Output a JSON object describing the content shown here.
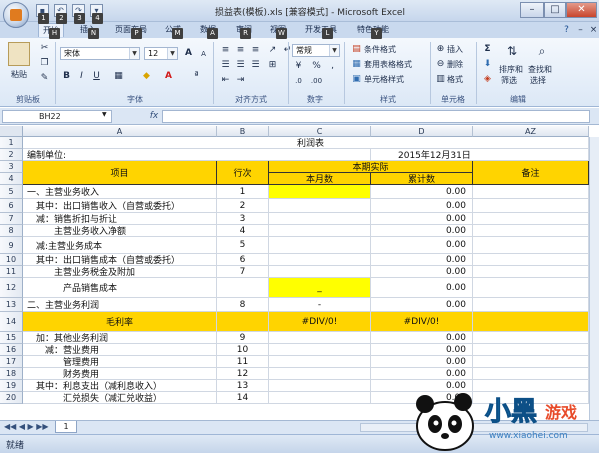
{
  "window": {
    "title": "损益表(模板).xls  [兼容模式] - Microsoft Excel",
    "minimize": "–",
    "maximize": "□",
    "close": "✕"
  },
  "qat": {
    "office_key": "F",
    "keys": [
      "1",
      "2",
      "3",
      "4"
    ]
  },
  "tabs": [
    {
      "label": "开始",
      "key": "H"
    },
    {
      "label": "插入",
      "key": "N"
    },
    {
      "label": "页面布局",
      "key": "P"
    },
    {
      "label": "公式",
      "key": "M"
    },
    {
      "label": "数据",
      "key": "A"
    },
    {
      "label": "审阅",
      "key": "R"
    },
    {
      "label": "视图",
      "key": "W"
    },
    {
      "label": "开发工具",
      "key": "L"
    },
    {
      "label": "特色功能",
      "key": "Y"
    }
  ],
  "ribbon": {
    "clipboard": {
      "paste": "粘贴",
      "label": "剪贴板"
    },
    "font": {
      "name": "宋体",
      "size": "12",
      "label": "字体",
      "bold": "B",
      "italic": "I",
      "underline": "U",
      "grow": "A",
      "shrink": "A"
    },
    "alignment": {
      "label": "对齐方式"
    },
    "number": {
      "format": "常规",
      "label": "数字",
      "currency": "¥",
      "percent": "%",
      "comma": ","
    },
    "styles": {
      "conditional": "条件格式",
      "table": "套用表格格式",
      "cell": "单元格样式",
      "label": "样式"
    },
    "cells": {
      "insert": "插入",
      "delete": "删除",
      "format": "格式",
      "label": "单元格"
    },
    "editing": {
      "sum": "Σ",
      "sort": "排序和\n筛选",
      "find": "查找和\n选择",
      "sort1": "排序和",
      "sort2": "筛选",
      "find1": "查找和",
      "find2": "选择",
      "label": "编辑"
    }
  },
  "formula_bar": {
    "name_box": "BH22",
    "fx": "fx",
    "value": ""
  },
  "columns": [
    {
      "label": "A"
    },
    {
      "label": "B"
    },
    {
      "label": "C"
    },
    {
      "label": "D"
    },
    {
      "label": "AZ"
    }
  ],
  "sheet": {
    "title": "利润表",
    "unit_label": "编制单位:",
    "date": "2015年12月31日",
    "header_item": "项目",
    "header_row": "行次",
    "header_period": "本期实际",
    "header_month": "本月数",
    "header_cum": "累计数",
    "header_note": "备注"
  },
  "rows": [
    {
      "num": "5",
      "item": "一、主营业务收入",
      "line": "1",
      "month": "",
      "cum": "0.00",
      "indent": 0
    },
    {
      "num": "6",
      "item": "其中：出口销售收入（自营或委托）",
      "line": "2",
      "month": "",
      "cum": "0.00",
      "indent": 1
    },
    {
      "num": "7",
      "item": "减：销售折扣与折让",
      "line": "3",
      "month": "",
      "cum": "0.00",
      "indent": 1
    },
    {
      "num": "8",
      "item": "主营业务收入净额",
      "line": "4",
      "month": "",
      "cum": "0.00",
      "indent": 3
    },
    {
      "num": "9",
      "item": "减:主营业务成本",
      "line": "5",
      "month": "",
      "cum": "0.00",
      "indent": 1
    },
    {
      "num": "10",
      "item": "其中：出口销售成本（自营或委托）",
      "line": "6",
      "month": "",
      "cum": "0.00",
      "indent": 1
    },
    {
      "num": "11",
      "item": "主营业务税金及附加",
      "line": "7",
      "month": "",
      "cum": "0.00",
      "indent": 3
    },
    {
      "num": "12",
      "item": "产品销售成本",
      "line": "",
      "month": "_",
      "cum": "0.00",
      "indent": 4
    },
    {
      "num": "13",
      "item": "二、主营业务利润",
      "line": "8",
      "month": "-",
      "cum": "0.00",
      "indent": 0
    },
    {
      "num": "14",
      "item": "毛利率",
      "line": "",
      "month": "#DIV/0!",
      "cum": "#DIV/0!",
      "indent": 6
    },
    {
      "num": "15",
      "item": "加：其他业务利润",
      "line": "9",
      "month": "",
      "cum": "0.00",
      "indent": 1
    },
    {
      "num": "16",
      "item": "减：营业费用",
      "line": "10",
      "month": "",
      "cum": "0.00",
      "indent": 2
    },
    {
      "num": "17",
      "item": "管理费用",
      "line": "11",
      "month": "",
      "cum": "0.00",
      "indent": 4
    },
    {
      "num": "18",
      "item": "财务费用",
      "line": "12",
      "month": "",
      "cum": "0.00",
      "indent": 4
    },
    {
      "num": "19",
      "item": "其中：利息支出（减利息收入）",
      "line": "13",
      "month": "",
      "cum": "0.00",
      "indent": 1
    },
    {
      "num": "20",
      "item": "汇兑损失（减汇兑收益）",
      "line": "14",
      "month": "",
      "cum": "0.00",
      "indent": 4
    }
  ],
  "top_row_nums": [
    "1",
    "2",
    "3",
    "4"
  ],
  "status": {
    "ready": "就绪",
    "sheet_tab": "1",
    "watermark_url": "www.xiaohei.com"
  },
  "colors": {
    "header_yellow": "#ffd400",
    "input_yellow": "#ffff00",
    "ribbon_blue": "#dce8f6"
  }
}
